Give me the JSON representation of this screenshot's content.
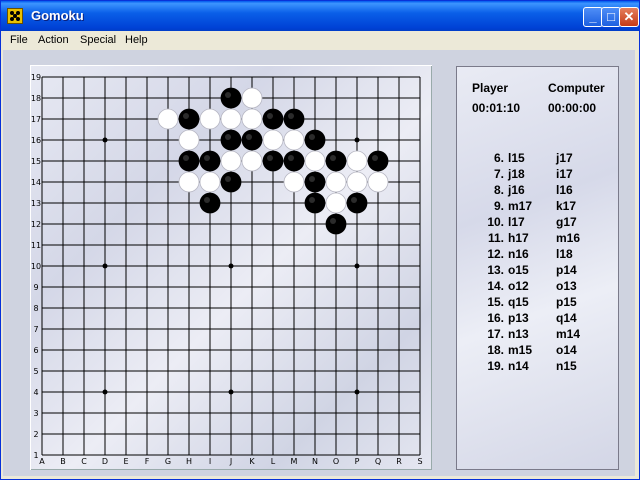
{
  "window": {
    "title": "Gomoku",
    "icon": "gomoku-app-icon"
  },
  "titlebar_buttons": {
    "minimize": "_",
    "maximize": "□",
    "close": "✕"
  },
  "menu": [
    "File",
    "Action",
    "Special",
    "Help"
  ],
  "board": {
    "size": 19,
    "columns": [
      "A",
      "B",
      "C",
      "D",
      "E",
      "F",
      "G",
      "H",
      "I",
      "J",
      "K",
      "L",
      "M",
      "N",
      "O",
      "P",
      "Q",
      "R",
      "S"
    ],
    "rows": [
      "19",
      "18",
      "17",
      "16",
      "15",
      "14",
      "13",
      "12",
      "11",
      "10",
      "9",
      "8",
      "7",
      "6",
      "5",
      "4",
      "3",
      "2",
      "1"
    ],
    "star_points": [
      "D16",
      "J16",
      "P16",
      "D10",
      "J10",
      "P10",
      "D4",
      "J4",
      "P4"
    ],
    "stone_colors": {
      "black": "#000000",
      "white": "#ffffff"
    },
    "stones": [
      {
        "pos": "J18",
        "color": "black"
      },
      {
        "pos": "K18",
        "color": "white"
      },
      {
        "pos": "G17",
        "color": "white"
      },
      {
        "pos": "H17",
        "color": "black"
      },
      {
        "pos": "I17",
        "color": "white"
      },
      {
        "pos": "J17",
        "color": "white"
      },
      {
        "pos": "K17",
        "color": "white"
      },
      {
        "pos": "L17",
        "color": "black"
      },
      {
        "pos": "M17",
        "color": "black"
      },
      {
        "pos": "H16",
        "color": "white"
      },
      {
        "pos": "J16",
        "color": "black"
      },
      {
        "pos": "K16",
        "color": "black"
      },
      {
        "pos": "L16",
        "color": "white"
      },
      {
        "pos": "M16",
        "color": "white"
      },
      {
        "pos": "N16",
        "color": "black"
      },
      {
        "pos": "H15",
        "color": "black"
      },
      {
        "pos": "I15",
        "color": "black"
      },
      {
        "pos": "J15",
        "color": "white"
      },
      {
        "pos": "K15",
        "color": "white"
      },
      {
        "pos": "L15",
        "color": "black"
      },
      {
        "pos": "M15",
        "color": "black"
      },
      {
        "pos": "N15",
        "color": "white"
      },
      {
        "pos": "O15",
        "color": "black"
      },
      {
        "pos": "P15",
        "color": "white"
      },
      {
        "pos": "Q15",
        "color": "black"
      },
      {
        "pos": "H14",
        "color": "white"
      },
      {
        "pos": "I14",
        "color": "white"
      },
      {
        "pos": "J14",
        "color": "black"
      },
      {
        "pos": "M14",
        "color": "white"
      },
      {
        "pos": "N14",
        "color": "black"
      },
      {
        "pos": "O14",
        "color": "white"
      },
      {
        "pos": "P14",
        "color": "white"
      },
      {
        "pos": "Q14",
        "color": "white"
      },
      {
        "pos": "I13",
        "color": "black"
      },
      {
        "pos": "N13",
        "color": "black"
      },
      {
        "pos": "O13",
        "color": "white"
      },
      {
        "pos": "P13",
        "color": "black"
      },
      {
        "pos": "O12",
        "color": "black"
      }
    ]
  },
  "score_panel": {
    "player_label": "Player",
    "computer_label": "Computer",
    "player_time": "00:01:10",
    "computer_time": "00:00:00",
    "moves": [
      {
        "num": "6.",
        "player": "l15",
        "computer": "j17"
      },
      {
        "num": "7.",
        "player": "j18",
        "computer": "i17"
      },
      {
        "num": "8.",
        "player": "j16",
        "computer": "l16"
      },
      {
        "num": "9.",
        "player": "m17",
        "computer": "k17"
      },
      {
        "num": "10.",
        "player": "l17",
        "computer": "g17"
      },
      {
        "num": "11.",
        "player": "h17",
        "computer": "m16"
      },
      {
        "num": "12.",
        "player": "n16",
        "computer": "l18"
      },
      {
        "num": "13.",
        "player": "o15",
        "computer": "p14"
      },
      {
        "num": "14.",
        "player": "o12",
        "computer": "o13"
      },
      {
        "num": "15.",
        "player": "q15",
        "computer": "p15"
      },
      {
        "num": "16.",
        "player": "p13",
        "computer": "q14"
      },
      {
        "num": "17.",
        "player": "n13",
        "computer": "m14"
      },
      {
        "num": "18.",
        "player": "m15",
        "computer": "o14"
      },
      {
        "num": "19.",
        "player": "n14",
        "computer": "n15"
      }
    ]
  }
}
